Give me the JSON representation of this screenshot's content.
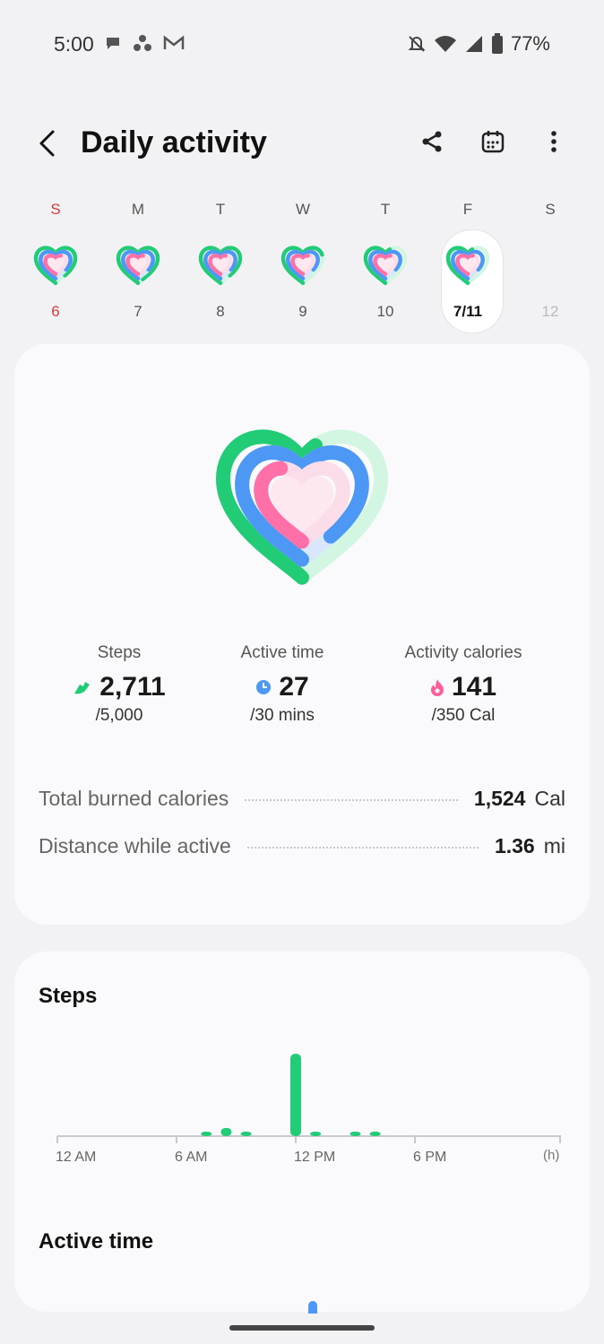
{
  "status_bar": {
    "time": "5:00",
    "notification_icons": [
      "chat-icon",
      "dots-icon",
      "gmail-icon"
    ],
    "system_icons": [
      "mute-icon",
      "wifi-icon",
      "signal-icon",
      "battery-icon"
    ],
    "battery": "77%"
  },
  "header": {
    "title": "Daily activity",
    "actions": [
      "share-icon",
      "calendar-icon",
      "more-icon"
    ]
  },
  "week": [
    {
      "letter": "S",
      "number": "6",
      "state": "sunday"
    },
    {
      "letter": "M",
      "number": "7",
      "state": "normal"
    },
    {
      "letter": "T",
      "number": "8",
      "state": "normal"
    },
    {
      "letter": "W",
      "number": "9",
      "state": "normal"
    },
    {
      "letter": "T",
      "number": "10",
      "state": "normal"
    },
    {
      "letter": "F",
      "number": "7/11",
      "state": "selected"
    },
    {
      "letter": "S",
      "number": "12",
      "state": "future"
    }
  ],
  "summary": {
    "rings": {
      "steps_progress": 0.54,
      "active_progress": 0.9,
      "calories_progress": 0.4
    },
    "colors": {
      "steps": "#22cc77",
      "active": "#4d97f5",
      "calories": "#ff6fa8"
    },
    "metrics": [
      {
        "label": "Steps",
        "value": "2,711",
        "goal": "/5,000",
        "icon": "shoe-icon"
      },
      {
        "label": "Active time",
        "value": "27",
        "goal": "/30 mins",
        "icon": "clock-icon"
      },
      {
        "label": "Activity calories",
        "value": "141",
        "goal": "/350 Cal",
        "icon": "flame-icon"
      }
    ],
    "stats": [
      {
        "label": "Total burned calories",
        "value": "1,524",
        "unit": "Cal"
      },
      {
        "label": "Distance while active",
        "value": "1.36",
        "unit": "mi"
      }
    ]
  },
  "steps_section": {
    "title": "Steps",
    "chart_data": {
      "type": "bar",
      "x_labels": [
        "12 AM",
        "6 AM",
        "12 PM",
        "6 PM"
      ],
      "unit_label": "(h)",
      "xlim": [
        0,
        24
      ],
      "x": [
        7.5,
        8.5,
        9.5,
        12,
        13,
        15,
        16
      ],
      "values": [
        60,
        110,
        60,
        1100,
        60,
        60,
        60
      ],
      "ylim": [
        0,
        1150
      ],
      "color": "#22cc77"
    }
  },
  "active_section": {
    "title": "Active time"
  }
}
